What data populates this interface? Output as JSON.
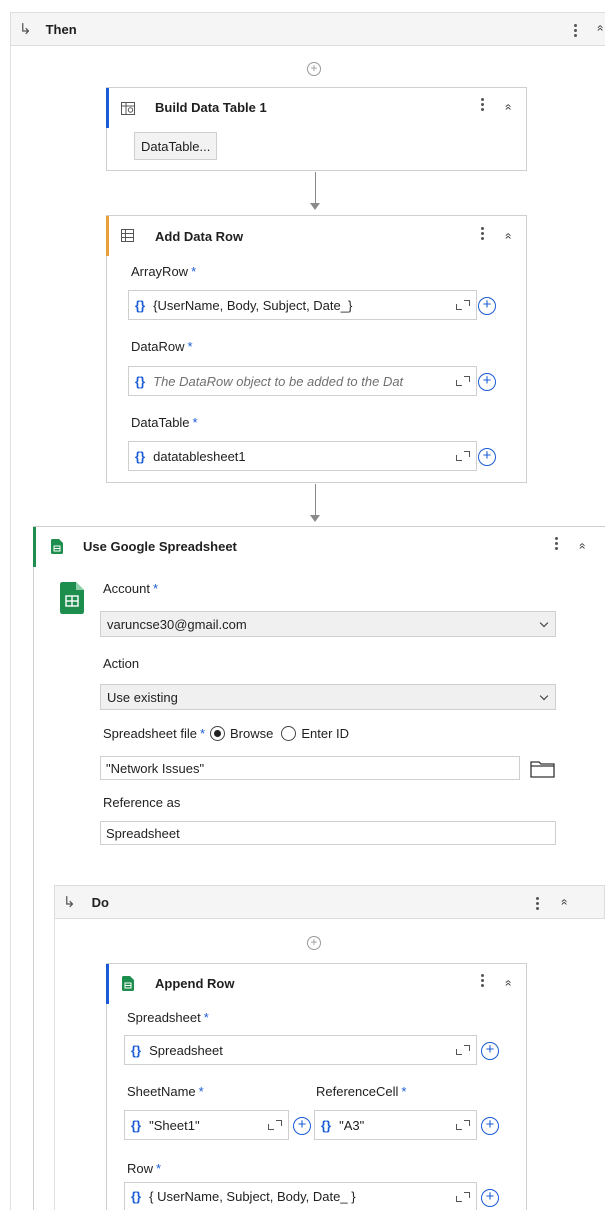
{
  "then_sequence": {
    "title": "Then"
  },
  "build_table": {
    "title": "Build Data Table 1",
    "button_label": "DataTable..."
  },
  "add_row": {
    "title": "Add Data Row",
    "fields": [
      {
        "label": "ArrayRow",
        "required": "*",
        "value": "{UserName, Body, Subject, Date_}",
        "placeholder": ""
      },
      {
        "label": "DataRow",
        "required": "*",
        "value": "",
        "placeholder": "The DataRow object to be added to the Dat"
      },
      {
        "label": "DataTable",
        "required": "*",
        "value": "datatablesheet1",
        "placeholder": ""
      }
    ]
  },
  "google_sheet": {
    "title": "Use Google Spreadsheet",
    "account_label": "Account",
    "account_required": "*",
    "account_value": "varuncse30@gmail.com",
    "action_label": "Action",
    "action_value": "Use existing",
    "file_label": "Spreadsheet file",
    "file_required": "*",
    "radio_browse": "Browse",
    "radio_enter_id": "Enter ID",
    "file_value": "\"Network Issues\"",
    "reference_label": "Reference as",
    "reference_value": "Spreadsheet"
  },
  "do_sequence": {
    "title": "Do"
  },
  "append_row": {
    "title": "Append Row",
    "spreadsheet_label": "Spreadsheet",
    "spreadsheet_required": "*",
    "spreadsheet_value": "Spreadsheet",
    "sheetname_label": "SheetName",
    "sheetname_required": "*",
    "sheetname_value": "\"Sheet1\"",
    "refcell_label": "ReferenceCell",
    "refcell_required": "*",
    "refcell_value": "\"A3\"",
    "row_label": "Row",
    "row_required": "*",
    "row_value": "{ UserName, Subject, Body, Date_ }"
  },
  "glyphs": {
    "brace": "{}",
    "plus": "+",
    "collapse": "»",
    "sequence_arrow": "↳"
  },
  "colors": {
    "accent_blue": "#1a5cd6",
    "accent_orange": "#e8a13a",
    "sheets_green": "#1e8e4e"
  }
}
